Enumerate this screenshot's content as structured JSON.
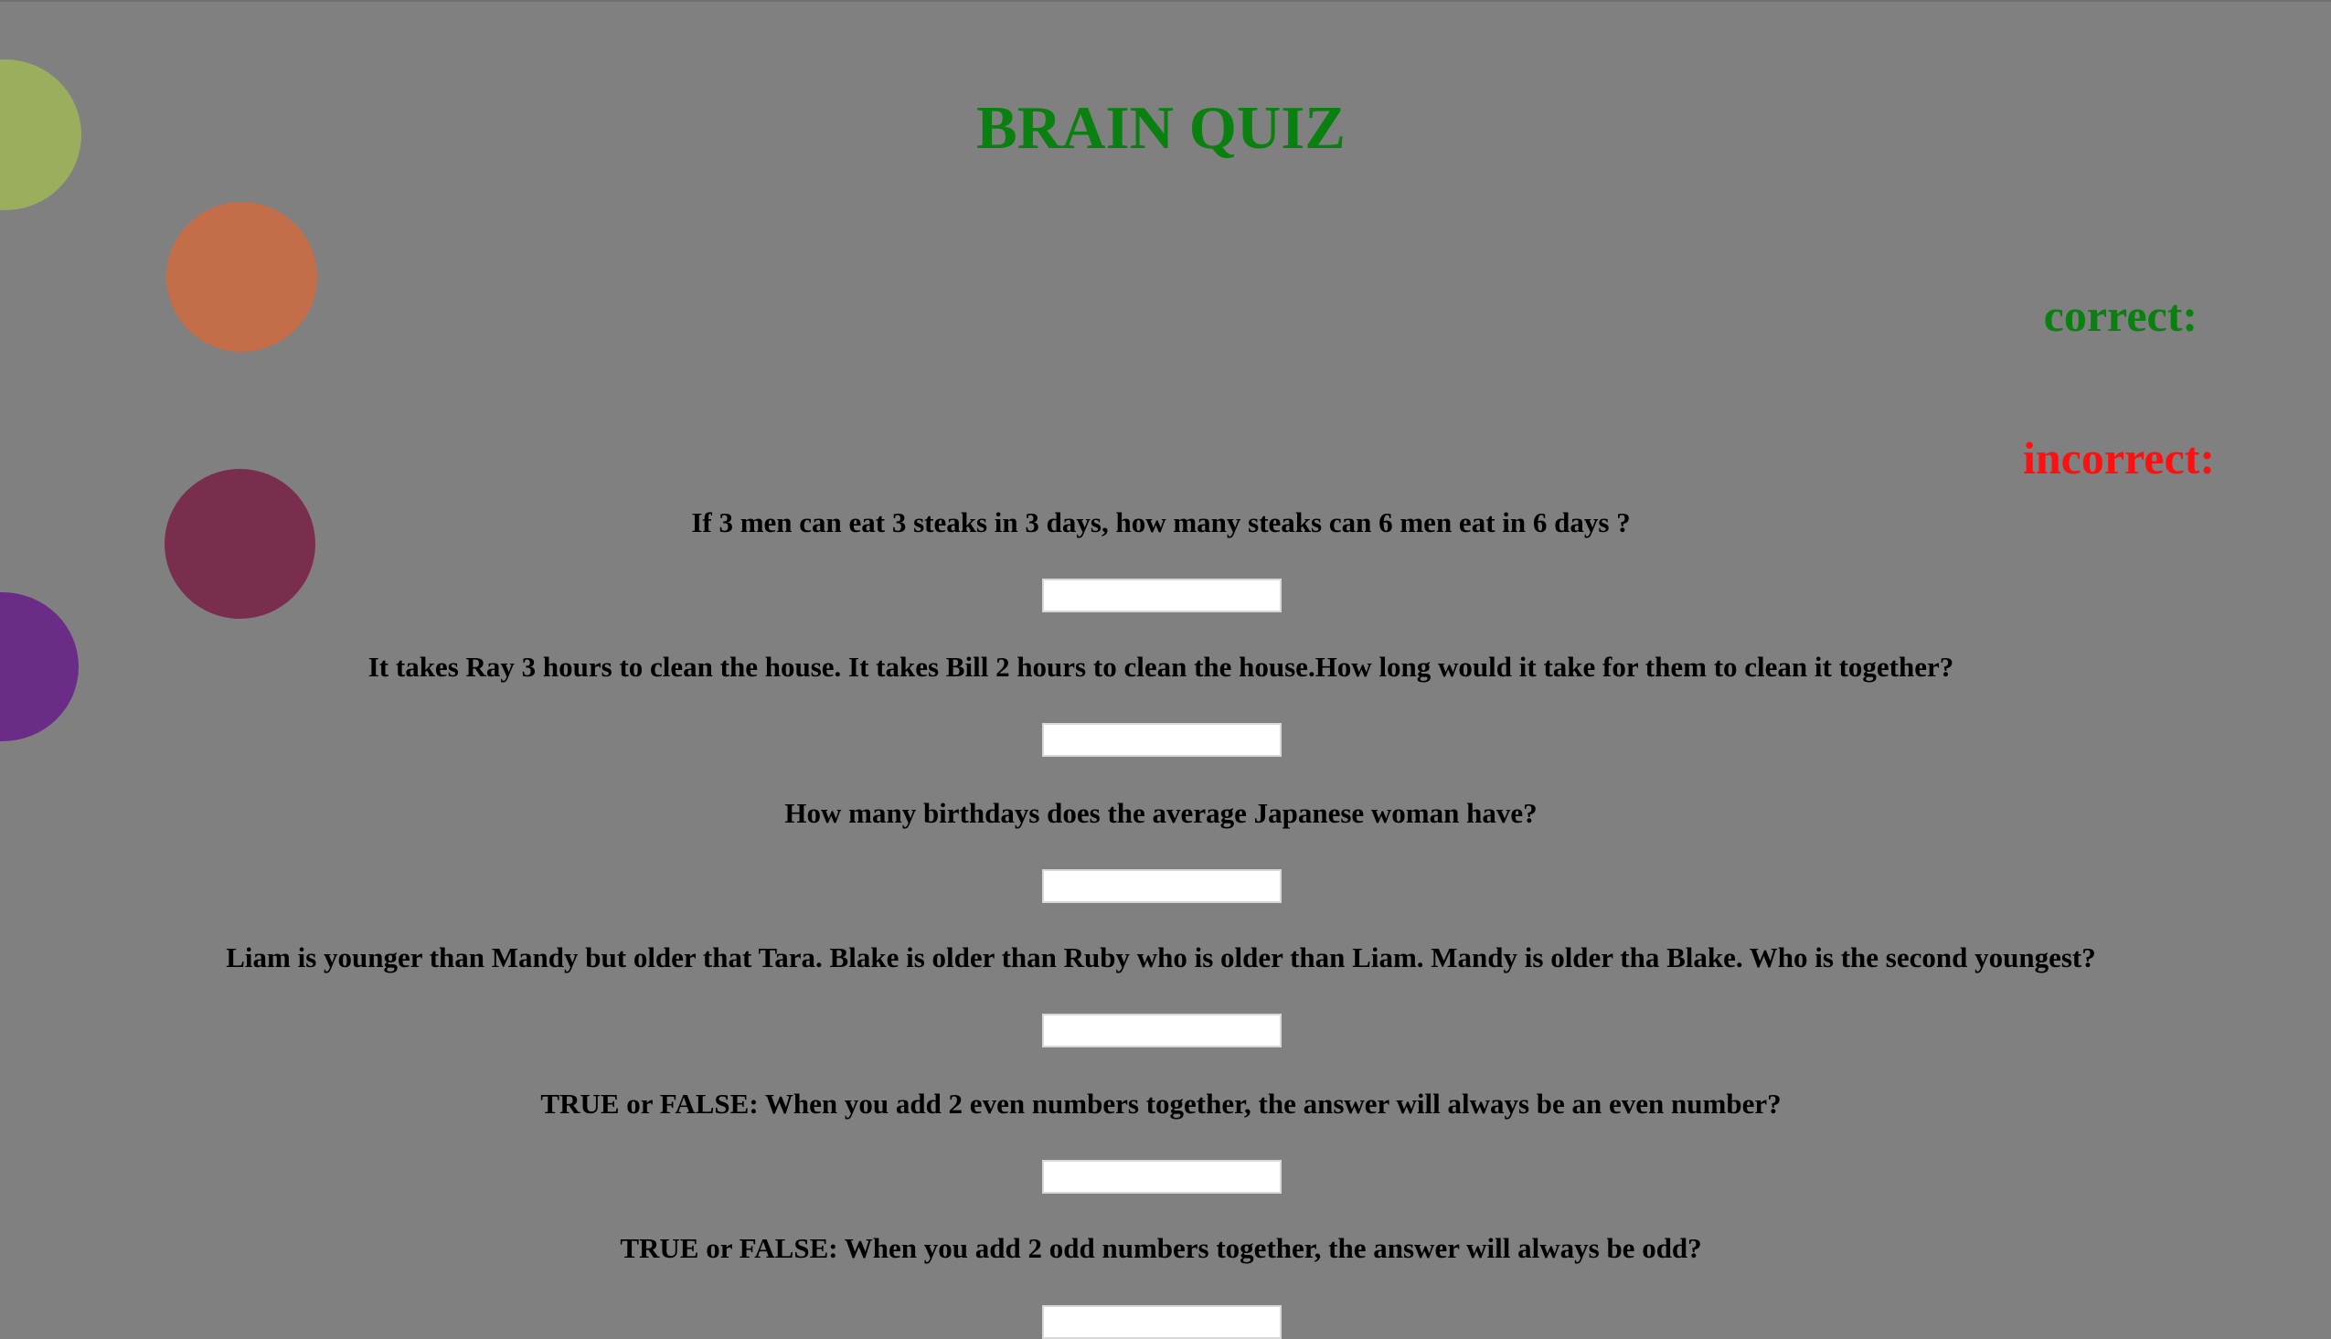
{
  "quiz": {
    "title": "BRAIN QUIZ",
    "title_color": "#0a8010",
    "correct_label": "correct:",
    "correct_color": "#0a8010",
    "incorrect_label": "incorrect:",
    "incorrect_color": "#ff1010",
    "questions": [
      {
        "text": "If 3 men can eat 3 steaks in 3 days, how many steaks can 6 men eat in 6 days ?",
        "answer": ""
      },
      {
        "text": "It takes Ray 3 hours to clean the house. It takes Bill 2 hours to clean the house.How long would it take for them to clean it together?",
        "answer": ""
      },
      {
        "text": "How many birthdays does the average Japanese woman have?",
        "answer": ""
      },
      {
        "text": "Liam is younger than Mandy but older that Tara. Blake is older than Ruby who is older than Liam. Mandy is older tha Blake. Who is the second youngest?",
        "answer": ""
      },
      {
        "text": "TRUE or FALSE: When you add 2 even numbers together, the answer will always be an even number?",
        "answer": ""
      },
      {
        "text": "TRUE or FALSE: When you add 2 odd numbers together, the answer will always be odd?",
        "answer": ""
      }
    ]
  },
  "decorations": {
    "circle_colors": [
      "#9aae5e",
      "#c36e48",
      "#7a2e4e",
      "#6b2c88"
    ]
  }
}
